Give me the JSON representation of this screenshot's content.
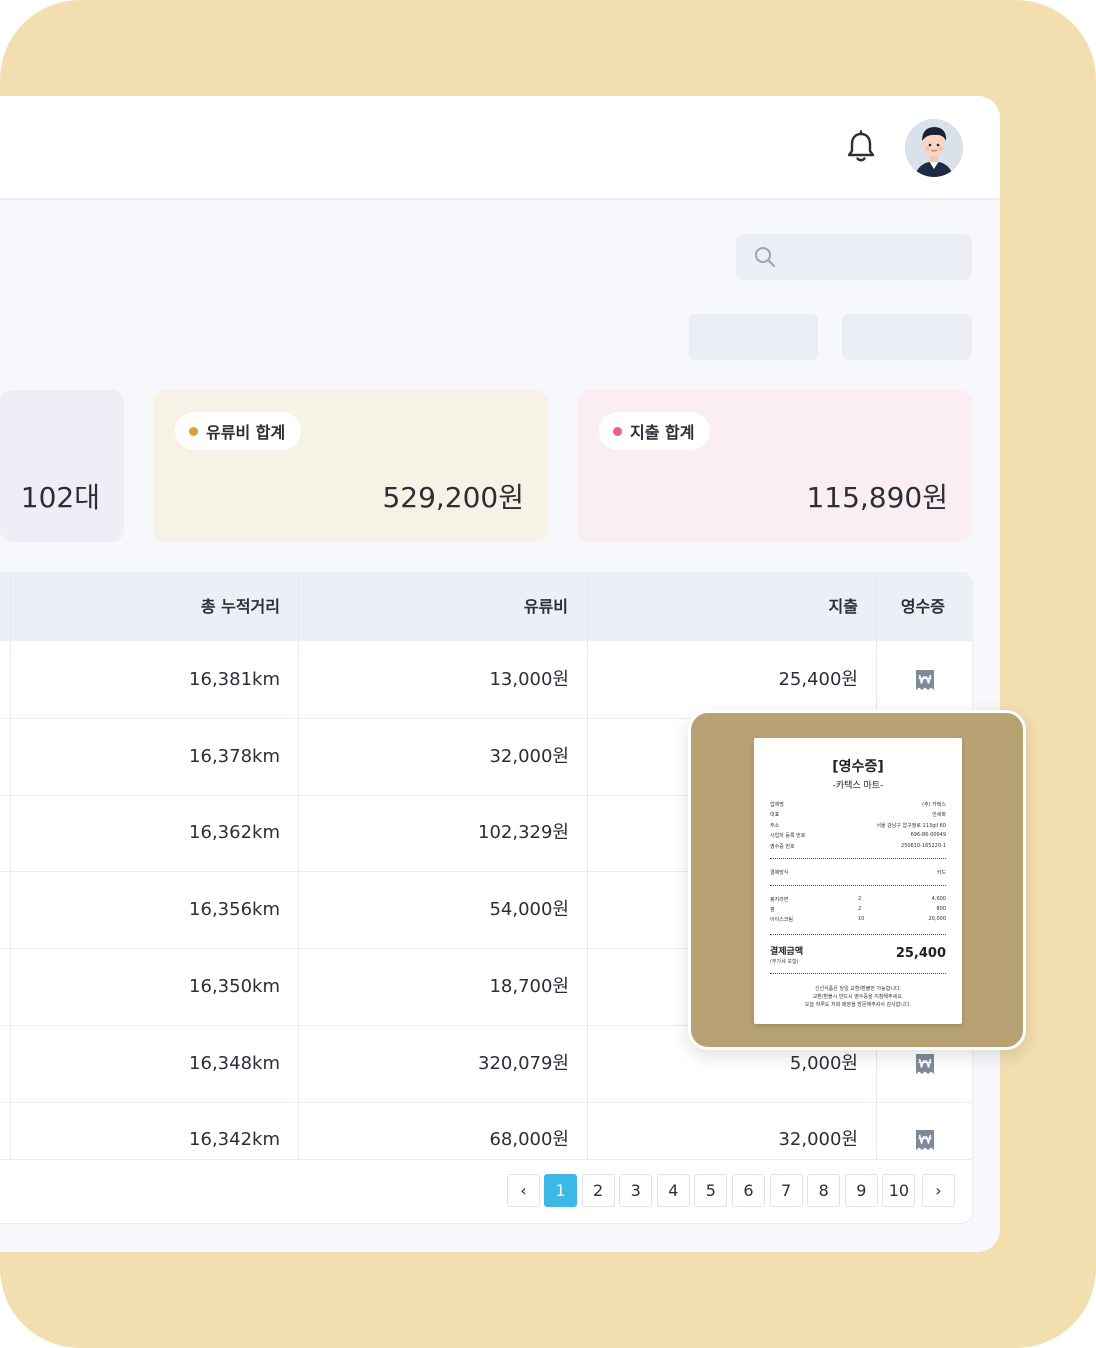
{
  "summary": {
    "vehicle_count": "102대",
    "fuel": {
      "label": "유류비 합계",
      "value": "529,200원",
      "dot_color": "#e0a030",
      "bg": "#f6f2e6"
    },
    "expense": {
      "label": "지출 합계",
      "value": "115,890원",
      "dot_color": "#e8609a",
      "bg": "#fbeef3"
    }
  },
  "table": {
    "headers": {
      "distance": "총 누적거리",
      "fuel": "유류비",
      "expense": "지출",
      "receipt": "영수증"
    },
    "rows": [
      {
        "distance": "16,381km",
        "fuel": "13,000원",
        "expense": "25,400원"
      },
      {
        "distance": "16,378km",
        "fuel": "32,000원",
        "expense": ""
      },
      {
        "distance": "16,362km",
        "fuel": "102,329원",
        "expense": ""
      },
      {
        "distance": "16,356km",
        "fuel": "54,000원",
        "expense": ""
      },
      {
        "distance": "16,350km",
        "fuel": "18,700원",
        "expense": ""
      },
      {
        "distance": "16,348km",
        "fuel": "320,079원",
        "expense": "5,000원"
      },
      {
        "distance": "16,342km",
        "fuel": "68,000원",
        "expense": "32,000원"
      }
    ]
  },
  "pagination": {
    "prev": "‹",
    "next": "›",
    "pages": [
      "1",
      "2",
      "3",
      "4",
      "5",
      "6",
      "7",
      "8",
      "9",
      "10"
    ],
    "current": "1",
    "accent": "#3cb8e6"
  },
  "receipt": {
    "title": "[영수증]",
    "store": "-카택스 마트-",
    "info": [
      {
        "k": "업체명",
        "v": "(주) 카택스"
      },
      {
        "k": "대표",
        "v": "안세화"
      },
      {
        "k": "주소",
        "v": "서울 강남구 압구정로 113gil 60"
      },
      {
        "k": "사업자 등록 번호",
        "v": "696-86-00649"
      },
      {
        "k": "영수증 번호",
        "v": "250610-165220-1"
      }
    ],
    "payment": {
      "k": "결제방식",
      "v": "카드"
    },
    "items": [
      {
        "name": "봉지라면",
        "qty": "2",
        "price": "4,600"
      },
      {
        "name": "껌",
        "qty": "2",
        "price": "800"
      },
      {
        "name": "아이스크림",
        "qty": "10",
        "price": "20,000"
      }
    ],
    "total_label": "결제금액",
    "total_sub": "(부가세 포함)",
    "total_value": "25,400",
    "footer": [
      "신선식품은 당일 교환/환불만 가능합니다.",
      "교환/환불시 반드시 영수증을 지참해주세요.",
      "오늘 하루도 저희 매장을 방문해주셔서 감사합니다."
    ]
  },
  "icons": {
    "bell": "bell-icon",
    "search": "search-icon",
    "receipt": "won-receipt-icon"
  }
}
